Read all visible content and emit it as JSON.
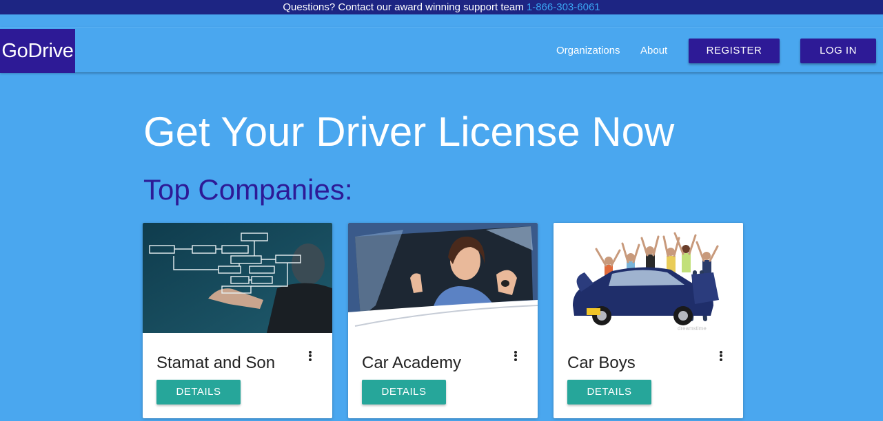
{
  "topbar": {
    "text": "Questions? Contact our award winning support team",
    "phone": "1-866-303-6061"
  },
  "navbar": {
    "logo": "GoDrive",
    "links": [
      "Organizations",
      "About"
    ],
    "register_label": "REGISTER",
    "login_label": "LOG IN"
  },
  "main": {
    "hero_title": "Get Your Driver License Now",
    "section_title": "Top Companies:"
  },
  "cards": [
    {
      "title": "Stamat and Son",
      "button_label": "DETAILS",
      "image": "business-flowchart-image"
    },
    {
      "title": "Car Academy",
      "button_label": "DETAILS",
      "image": "woman-driver-thumbs-up-image"
    },
    {
      "title": "Car Boys",
      "button_label": "DETAILS",
      "image": "people-cheering-on-car-image"
    }
  ],
  "colors": {
    "page_background": "#4aa7ef",
    "topbar_background": "#1d2583",
    "brand": "#2d1a96",
    "phone_link": "#3aa4f2",
    "details_button": "#26a69a"
  }
}
